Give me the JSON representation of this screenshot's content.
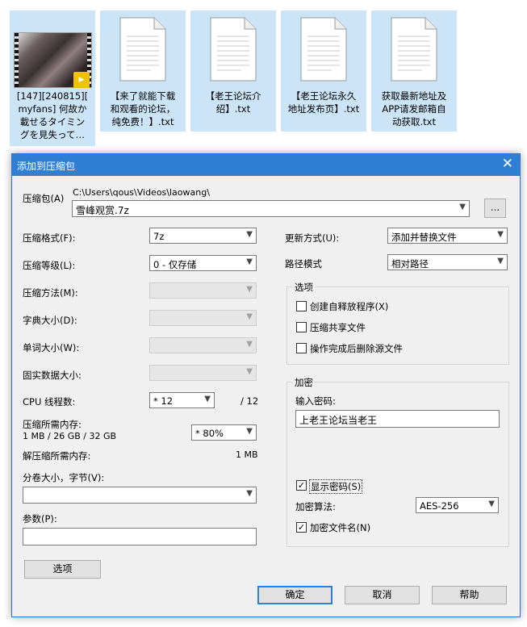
{
  "files": [
    {
      "name": "[147][240815][\nmyfans] 何故か\n載せるタイミン\nグを見失って…",
      "badge": "Player"
    },
    {
      "name": "【来了就能下载\n和观看的论坛，\n纯免费！】.txt"
    },
    {
      "name": "【老王论坛介\n绍】.txt"
    },
    {
      "name": "【老王论坛永久\n地址发布页】.txt"
    },
    {
      "name": "获取最新地址及\nAPP请发邮箱自\n动获取.txt"
    }
  ],
  "dialog": {
    "title": "添加到压缩包",
    "archive_label": "压缩包(A)",
    "archive_path": "C:\\Users\\qous\\Videos\\laowang\\",
    "archive_name": "雪峰观赏.7z",
    "browse_label": "...",
    "format_label": "压缩格式(F):",
    "format_value": "7z",
    "level_label": "压缩等级(L):",
    "level_value": "0 - 仅存储",
    "method_label": "压缩方法(M):",
    "dict_label": "字典大小(D):",
    "word_label": "单词大小(W):",
    "solid_label": "固实数据大小:",
    "cpu_label": "CPU 线程数:",
    "cpu_value": "* 12",
    "cpu_total": "/ 12",
    "mem_label": "压缩所需内存:",
    "mem_detail": "1 MB / 26 GB / 32 GB",
    "mem_percent": "* 80%",
    "decomp_label": "解压缩所需内存:",
    "decomp_value": "1 MB",
    "split_label": "分卷大小，字节(V):",
    "params_label": "参数(P):",
    "options_button": "选项",
    "update_label": "更新方式(U):",
    "update_value": "添加并替换文件",
    "path_label": "路径模式",
    "path_value": "相对路径",
    "options_group": "选项",
    "opt_sfx": "创建自释放程序(X)",
    "opt_shared": "压缩共享文件",
    "opt_delete": "操作完成后删除源文件",
    "encrypt_group": "加密",
    "password_label": "输入密码:",
    "password_value": "上老王论坛当老王",
    "show_password": "显示密码(S)",
    "algo_label": "加密算法:",
    "algo_value": "AES-256",
    "encrypt_names": "加密文件名(N)",
    "ok": "确定",
    "cancel": "取消",
    "help": "帮助"
  }
}
